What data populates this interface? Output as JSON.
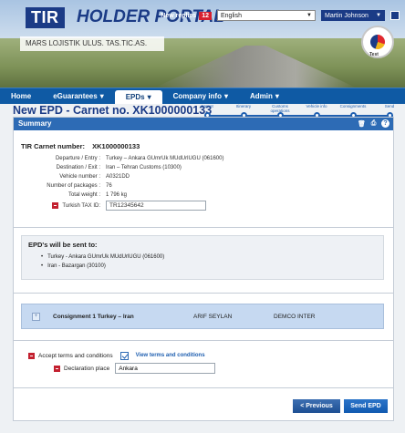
{
  "header": {
    "logo_tir": "TIR",
    "logo_text": "HOLDER PORTAL",
    "company": "MARS LOJISTIK ULUS. TAS.TIC.AS.",
    "new_replies_label": "New replies",
    "new_replies_count": "12",
    "language": "English",
    "user": "Martin Johnson",
    "seal_label": "Test"
  },
  "nav": {
    "items": [
      {
        "label": "Home",
        "has_caret": false
      },
      {
        "label": "eGuarantees",
        "has_caret": true
      },
      {
        "label": "EPDs",
        "has_caret": true
      },
      {
        "label": "Company info",
        "has_caret": true
      },
      {
        "label": "Admin",
        "has_caret": true
      }
    ],
    "caret": "▾"
  },
  "page": {
    "title": "New EPD - Carnet no. XK1000000133"
  },
  "steps": {
    "labels": [
      "Carnet",
      "Itinerary",
      "Customs operations",
      "Vehicle info",
      "Consignments",
      "Send"
    ]
  },
  "summary": {
    "header": "Summary",
    "carnet_label": "TIR Carnet number:",
    "carnet_number": "XK1000000133",
    "rows": [
      {
        "label": "Departure / Entry :",
        "value": "Turkey – Ankara GUmrUk MUdUrlUGU (061600)"
      },
      {
        "label": "Destination / Exit :",
        "value": "Iran – Tehran Customs (10300)"
      },
      {
        "label": "Vehicle number :",
        "value": "A0321DD"
      },
      {
        "label": "Number of packages :",
        "value": "76"
      },
      {
        "label": "Total weight :",
        "value": "1 796 kg"
      }
    ],
    "tax_label": "Turkish TAX ID:",
    "tax_value": "TR12345642"
  },
  "sent_to": {
    "title": "EPD's will be sent to:",
    "items": [
      "Turkey  -  Ankara GUmrUk MUdUrlUGU (061600)",
      "Iran  -  Bazargan (30100)"
    ]
  },
  "consignment": {
    "expand_symbol": "+",
    "name": "Consignment 1   Turkey – Iran",
    "person": "ARIF SEYLAN",
    "company": "DEMCO INTER"
  },
  "terms": {
    "label": "Accept terms and conditions",
    "checked": true,
    "link": "View terms and conditions"
  },
  "declaration": {
    "label": "Declaration place",
    "value": "Ankara"
  },
  "buttons": {
    "previous": "< Previous",
    "send": "Send EPD"
  },
  "panel_icons": {
    "trash": "🗑",
    "print": "⎙",
    "help": "?"
  }
}
